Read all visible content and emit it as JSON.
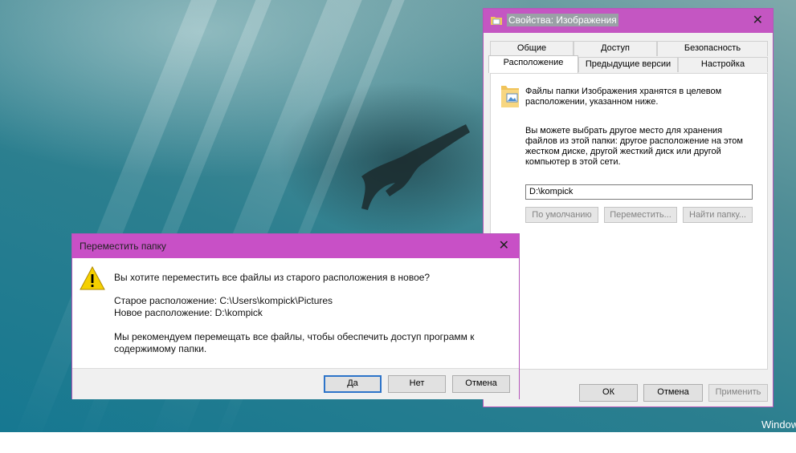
{
  "desktop": {
    "watermark": "Window"
  },
  "properties_dialog": {
    "title": "Свойства: Изображения",
    "close_glyph": "✕",
    "tabs_row1": [
      "Общие",
      "Доступ",
      "Безопасность"
    ],
    "tabs_row2": [
      "Расположение",
      "Предыдущие версии",
      "Настройка"
    ],
    "active_tab": "Расположение",
    "info_line1": "Файлы папки Изображения хранятся в целевом",
    "info_line2": "расположении, указанном ниже.",
    "desc_lines": [
      "Вы можете выбрать другое место для хранения",
      "файлов из этой папки: другое расположение на этом",
      "жестком диске, другой жесткий диск или другой",
      "компьютер в этой сети."
    ],
    "path_value": "D:\\kompick",
    "buttons": {
      "default": "По умолчанию",
      "move": "Переместить...",
      "find": "Найти папку..."
    },
    "footer": {
      "ok": "ОК",
      "cancel": "Отмена",
      "apply": "Применить"
    },
    "icons": [
      "folder-icon",
      "pictures-folder-icon",
      "close-icon"
    ]
  },
  "move_dialog": {
    "title": "Переместить папку",
    "close_glyph": "✕",
    "question": "Вы хотите переместить все файлы из старого расположения в новое?",
    "old_location": "Старое расположение: C:\\Users\\kompick\\Pictures",
    "new_location": "Новое расположение: D:\\kompick",
    "recommend_line1": "Мы рекомендуем перемещать все файлы, чтобы обеспечить доступ программ к",
    "recommend_line2": "содержимому папки.",
    "buttons": {
      "yes": "Да",
      "no": "Нет",
      "cancel": "Отмена"
    },
    "icons": [
      "warning-icon",
      "close-icon"
    ]
  },
  "colors": {
    "titlebar_accent": "#c850c6",
    "focus_border": "#2d74c9",
    "warning_yellow": "#f5d000"
  }
}
